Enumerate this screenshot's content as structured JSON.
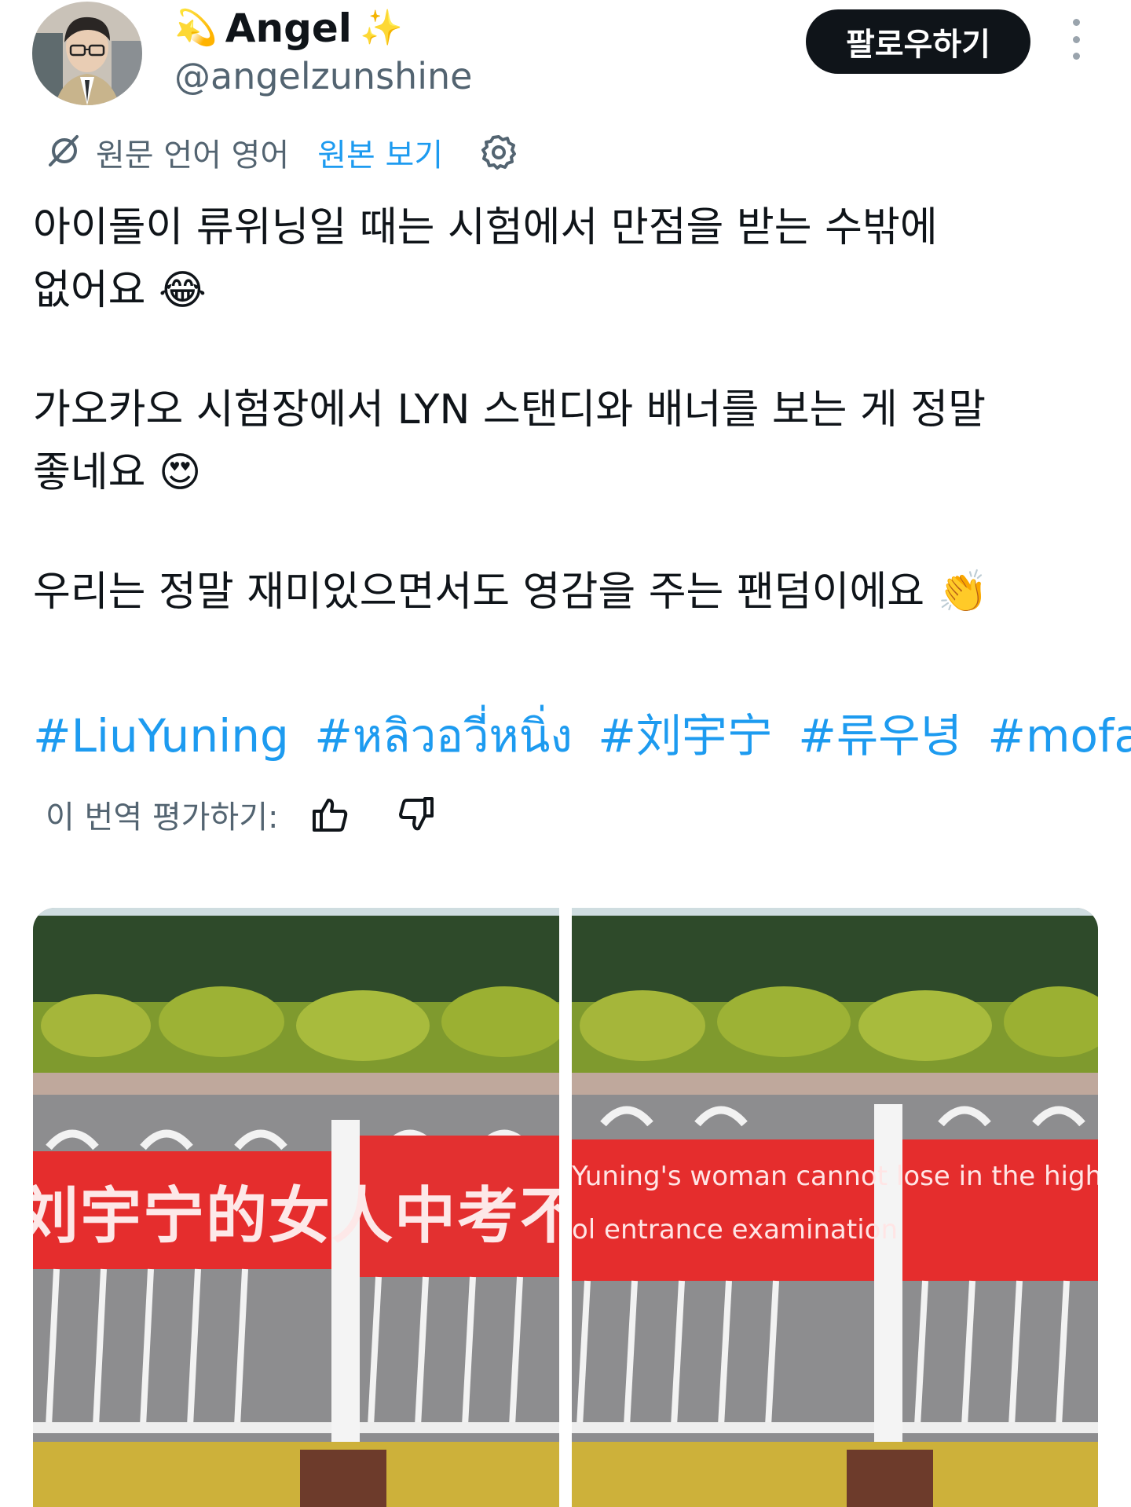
{
  "header": {
    "name_prefix_emoji": "💫",
    "display_name": "Angel",
    "name_suffix_emoji": "✨",
    "handle": "@angelzunshine",
    "follow_label": "팔로우하기",
    "more_icon": "more-vertical-icon"
  },
  "translation": {
    "icon": "translate-icon",
    "source_language": "원문 언어 영어",
    "show_original": "원본 보기",
    "settings_icon": "gear-icon"
  },
  "tweet": {
    "paragraph1_line1": "아이돌이 류위닝일 때는 시험에서 만점을 받는 수밖에",
    "paragraph1_line2": "없어요 😂",
    "paragraph2_line1": "가오카오 시험장에서 LYN 스탠디와 배너를 보는 게 정말",
    "paragraph2_line2": "좋네요 😍",
    "paragraph3": "우리는 정말 재미있으면서도 영감을 주는 팬덤이에요 👏",
    "hashtags": [
      "#LiuYuning",
      "#หลิวอวี่หนิ่ง",
      "#刘宇宁",
      "#류우녕",
      "#mofan"
    ]
  },
  "rating": {
    "label": "이 번역 평가하기:",
    "thumbs_up_icon": "thumbs-up-icon",
    "thumbs_down_icon": "thumbs-down-icon"
  },
  "media": {
    "photo1_banner_text": "刘宇宁的女人中考不能输",
    "photo2_banner_line1": "Yuning's woman cannot lose in the high",
    "photo2_banner_line2": "ol entrance examination"
  },
  "colors": {
    "accent": "#1d9bf0",
    "text": "#0f1419",
    "secondary": "#536471",
    "banner_red": "#e52d2d"
  }
}
